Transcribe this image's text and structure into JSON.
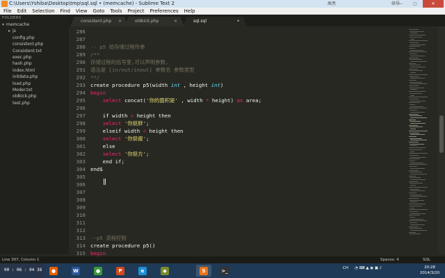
{
  "window": {
    "title": "C:\\Users\\Yshiba\\Desktop\\tmp\\sql.sql • (memcache) - Sublime Text 2",
    "ime_labels": [
      "高亮",
      "续导"
    ]
  },
  "menu": [
    "File",
    "Edit",
    "Selection",
    "Find",
    "View",
    "Goto",
    "Tools",
    "Project",
    "Preferences",
    "Help"
  ],
  "sidebar": {
    "header": "FOLDERS",
    "root": "memcache",
    "folders": [
      "js"
    ],
    "files": [
      "config.php",
      "consistent.php",
      "Consistent.txt",
      "exec.php",
      "hash.php",
      "index.html",
      "initdata.php",
      "load.php",
      "Moder.txt",
      "oldkick.php",
      "test.php"
    ]
  },
  "tabs": [
    {
      "label": "consistent.php",
      "active": false
    },
    {
      "label": "oldkick.php",
      "active": false
    },
    {
      "label": "sql.sql",
      "active": true
    }
  ],
  "tab_close": "×",
  "editor": {
    "lines": [
      {
        "n": "286",
        "t": []
      },
      {
        "n": "287",
        "t": []
      },
      {
        "n": "288",
        "t": [
          [
            "cm",
            "-- p5 给存储过程传参"
          ]
        ]
      },
      {
        "n": "289",
        "t": [
          [
            "cm",
            "/**"
          ]
        ]
      },
      {
        "n": "290",
        "t": [
          [
            "cm",
            "存储过程的括号里,可以声明参数,"
          ]
        ]
      },
      {
        "n": "291",
        "t": [
          [
            "cm",
            "语法是 [in/out/inout] 参数名 参数类型"
          ]
        ]
      },
      {
        "n": "292",
        "t": [
          [
            "cm",
            "**/"
          ]
        ]
      },
      {
        "n": "293",
        "t": [
          [
            "",
            "create procedure p5(width "
          ],
          [
            "ty",
            "int"
          ],
          [
            "",
            " , height "
          ],
          [
            "ty",
            "int"
          ],
          [
            "",
            ")"
          ]
        ]
      },
      {
        "n": "294",
        "t": [
          [
            "kw",
            "begin"
          ]
        ]
      },
      {
        "n": "295",
        "t": [
          [
            "",
            "    "
          ],
          [
            "kw",
            "select"
          ],
          [
            "",
            " concat("
          ],
          [
            "st",
            "'你的面积是'"
          ],
          [
            "",
            " , width "
          ],
          [
            "op",
            "*"
          ],
          [
            "",
            " height) "
          ],
          [
            "kw",
            "as"
          ],
          [
            "",
            " area;"
          ]
        ]
      },
      {
        "n": "296",
        "t": []
      },
      {
        "n": "297",
        "t": [
          [
            "",
            "    if width "
          ],
          [
            "op",
            ">"
          ],
          [
            "",
            " height then"
          ]
        ]
      },
      {
        "n": "298",
        "t": [
          [
            "",
            "    "
          ],
          [
            "kw",
            "select"
          ],
          [
            "",
            " "
          ],
          [
            "st",
            "'你挺胖'"
          ],
          [
            "",
            ";"
          ]
        ]
      },
      {
        "n": "299",
        "t": [
          [
            "",
            "    elseif width "
          ],
          [
            "op",
            "<"
          ],
          [
            "",
            " height then"
          ]
        ]
      },
      {
        "n": "300",
        "t": [
          [
            "",
            "    "
          ],
          [
            "kw",
            "select"
          ],
          [
            "",
            " "
          ],
          [
            "st",
            "'你挺瘦'"
          ],
          [
            "",
            ";"
          ]
        ]
      },
      {
        "n": "301",
        "t": [
          [
            "",
            "    else"
          ]
        ]
      },
      {
        "n": "302",
        "t": [
          [
            "",
            "    "
          ],
          [
            "kw",
            "select"
          ],
          [
            "",
            " "
          ],
          [
            "st",
            "'你挺方'"
          ],
          [
            "",
            ";"
          ]
        ]
      },
      {
        "n": "303",
        "t": [
          [
            "",
            "    end if;"
          ]
        ]
      },
      {
        "n": "304",
        "t": [
          [
            "",
            "end$"
          ]
        ]
      },
      {
        "n": "305",
        "t": []
      },
      {
        "n": "306",
        "t": []
      },
      {
        "n": "307",
        "t": []
      },
      {
        "n": "308",
        "t": []
      },
      {
        "n": "309",
        "t": []
      },
      {
        "n": "310",
        "t": []
      },
      {
        "n": "311",
        "t": []
      },
      {
        "n": "312",
        "t": []
      },
      {
        "n": "313",
        "t": [
          [
            "cm",
            "--p5 流程控制"
          ]
        ]
      },
      {
        "n": "314",
        "t": [
          [
            "",
            "create procedure p5()"
          ]
        ]
      },
      {
        "n": "315",
        "t": [
          [
            "kw",
            "begin"
          ]
        ]
      }
    ]
  },
  "status": {
    "position": "Line 307, Column 1",
    "spaces": "Spaces: 4",
    "syntax": "SQL"
  },
  "taskbar": {
    "timer": "00 : 06 : 04",
    "timer_extra": "38",
    "apps": [
      {
        "name": "firefox",
        "color": "#e66000",
        "glyph": "●"
      },
      {
        "name": "word",
        "color": "#2b5797",
        "glyph": "W"
      },
      {
        "name": "chrome",
        "color": "#3c9a3c",
        "glyph": "●"
      },
      {
        "name": "powerpoint-like",
        "color": "#d04a1c",
        "glyph": "P"
      },
      {
        "name": "ie",
        "color": "#1e90d6",
        "glyph": "e"
      },
      {
        "name": "game",
        "color": "#7a8c2e",
        "glyph": "◆"
      },
      {
        "name": "sublime-text",
        "color": "#e8741c",
        "glyph": "S"
      },
      {
        "name": "terminal",
        "color": "#333333",
        "glyph": ">_"
      }
    ],
    "tray": [
      "CH"
    ],
    "clock_time": "20:28",
    "clock_date": "2014/3/20"
  }
}
